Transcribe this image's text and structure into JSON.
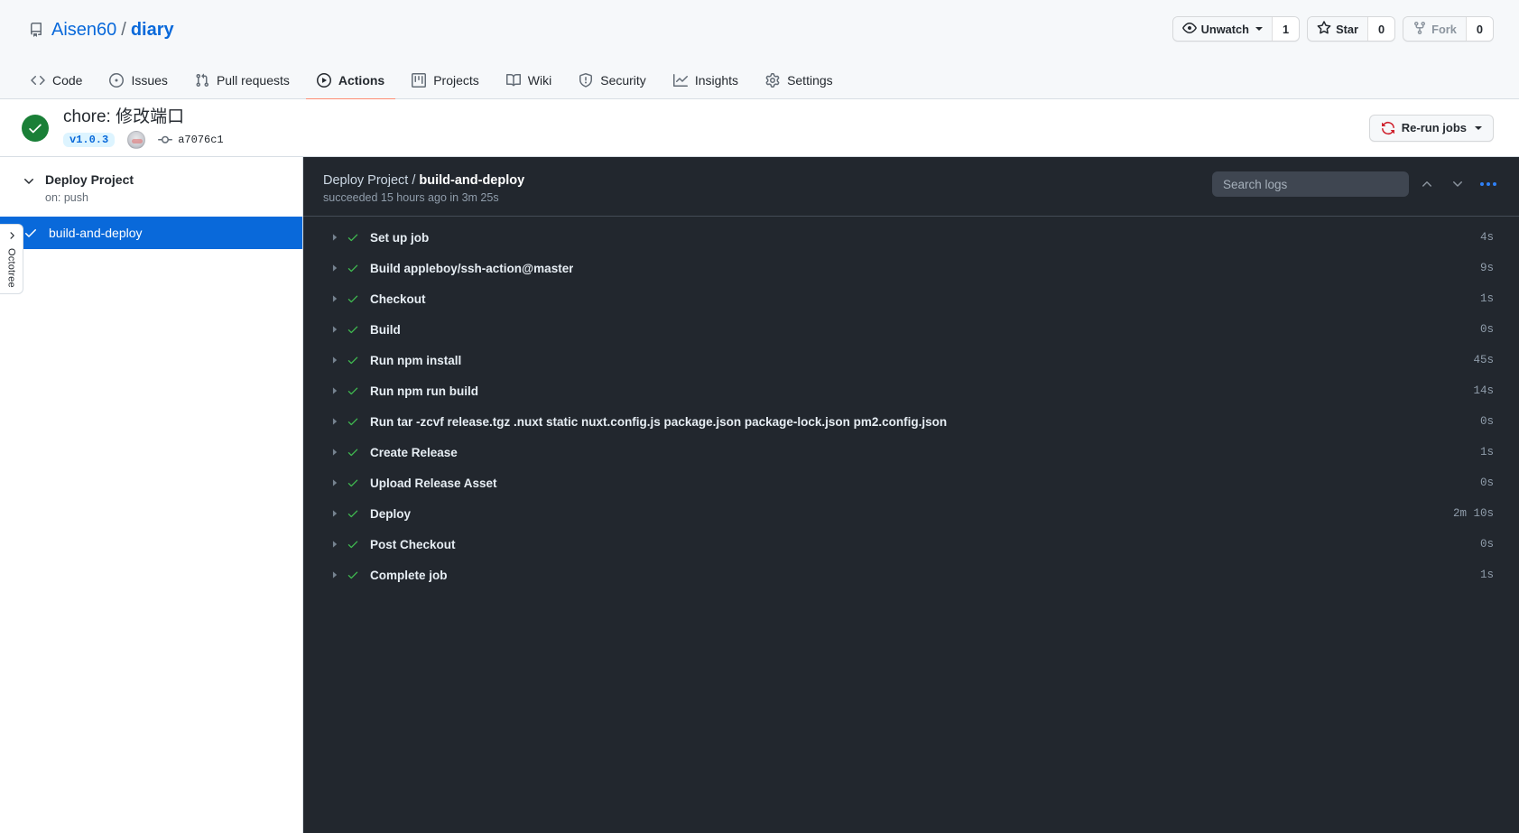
{
  "header": {
    "repo_icon": "repo-icon",
    "owner": "Aisen60",
    "separator": "/",
    "name": "diary",
    "social": {
      "watch_label": "Unwatch",
      "watch_count": "1",
      "star_label": "Star",
      "star_count": "0",
      "fork_label": "Fork",
      "fork_count": "0"
    },
    "nav": [
      {
        "label": "Code",
        "icon": "code-icon",
        "selected": false
      },
      {
        "label": "Issues",
        "icon": "issue-opened-icon",
        "selected": false
      },
      {
        "label": "Pull requests",
        "icon": "git-pull-request-icon",
        "selected": false
      },
      {
        "label": "Actions",
        "icon": "play-icon",
        "selected": true
      },
      {
        "label": "Projects",
        "icon": "project-icon",
        "selected": false
      },
      {
        "label": "Wiki",
        "icon": "book-icon",
        "selected": false
      },
      {
        "label": "Security",
        "icon": "shield-icon",
        "selected": false
      },
      {
        "label": "Insights",
        "icon": "graph-icon",
        "selected": false
      },
      {
        "label": "Settings",
        "icon": "gear-icon",
        "selected": false
      }
    ]
  },
  "run": {
    "status_icon": "check-circle-icon",
    "status_color": "#1a7f37",
    "title": "chore: 修改端口",
    "tag": "v1.0.3",
    "avatar": "user-avatar",
    "commit_icon": "git-commit-icon",
    "commit_sha": "a7076c1",
    "rerun_label": "Re-run jobs",
    "rerun_icon": "sync-icon",
    "rerun_icon_color": "#cf222e"
  },
  "sidebar": {
    "chevron_icon": "chevron-down-icon",
    "workflow_name": "Deploy Project",
    "workflow_trigger": "on: push",
    "job": {
      "label": "build-and-deploy",
      "icon": "check-icon",
      "selected": true,
      "selected_color": "#0969da"
    },
    "octotree": {
      "label": "Octotree",
      "icon": "chevron-right-icon"
    }
  },
  "logs": {
    "breadcrumb_workflow": "Deploy Project",
    "breadcrumb_separator": " / ",
    "breadcrumb_job": "build-and-deploy",
    "status_text": "succeeded 15 hours ago in 3m 25s",
    "search_placeholder": "Search logs",
    "search_value": "",
    "scroll_up_icon": "chevron-up-icon",
    "scroll_down_icon": "chevron-down-icon",
    "menu_icon": "kebab-horizontal-icon",
    "steps": [
      {
        "name": "Set up job",
        "duration": "4s",
        "status": "success"
      },
      {
        "name": "Build appleboy/ssh-action@master",
        "duration": "9s",
        "status": "success"
      },
      {
        "name": "Checkout",
        "duration": "1s",
        "status": "success"
      },
      {
        "name": "Build",
        "duration": "0s",
        "status": "success"
      },
      {
        "name": "Run npm install",
        "duration": "45s",
        "status": "success"
      },
      {
        "name": "Run npm run build",
        "duration": "14s",
        "status": "success"
      },
      {
        "name": "Run tar -zcvf release.tgz .nuxt static nuxt.config.js package.json package-lock.json pm2.config.json",
        "duration": "0s",
        "status": "success"
      },
      {
        "name": "Create Release",
        "duration": "1s",
        "status": "success"
      },
      {
        "name": "Upload Release Asset",
        "duration": "0s",
        "status": "success"
      },
      {
        "name": "Deploy",
        "duration": "2m 10s",
        "status": "success"
      },
      {
        "name": "Post Checkout",
        "duration": "0s",
        "status": "success"
      },
      {
        "name": "Complete job",
        "duration": "1s",
        "status": "success"
      }
    ]
  }
}
